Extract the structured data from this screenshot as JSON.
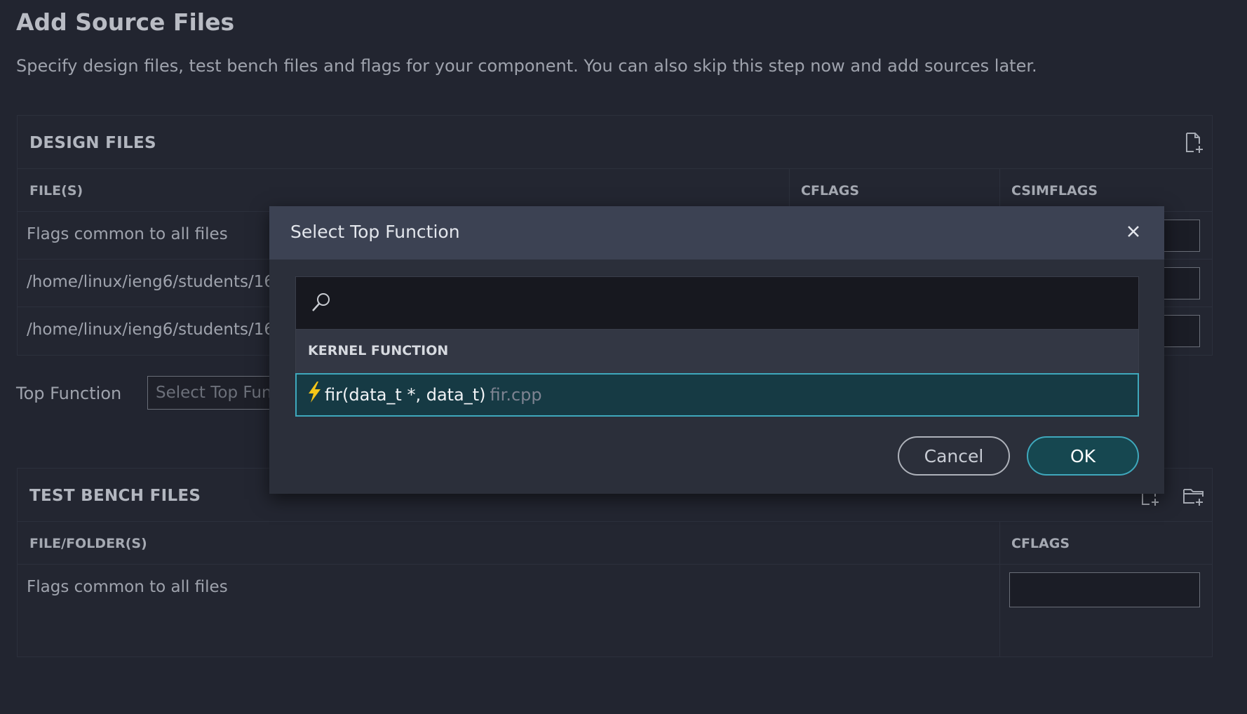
{
  "page": {
    "title": "Add Source Files",
    "description": "Specify design files, test bench files and flags for your component. You can also skip this step now and add sources later."
  },
  "design_files": {
    "title": "DESIGN FILES",
    "add_file_icon": "add-file-icon",
    "columns": [
      "FILE(S)",
      "CFLAGS",
      "CSIMFLAGS"
    ],
    "rows": [
      {
        "label": "Flags common to all files"
      },
      {
        "label": "/home/linux/ieng6/students/16"
      },
      {
        "label": "/home/linux/ieng6/students/16"
      }
    ]
  },
  "top_function": {
    "label": "Top Function",
    "placeholder": "Select Top Fun"
  },
  "test_bench_files": {
    "title": "TEST BENCH FILES",
    "add_file_icon": "add-file-icon",
    "add_folder_icon": "add-folder-icon",
    "columns": [
      "FILE/FOLDER(S)",
      "CFLAGS"
    ],
    "rows": [
      {
        "label": "Flags common to all files"
      }
    ]
  },
  "dialog": {
    "title": "Select Top Function",
    "close_icon": "close-icon",
    "search": {
      "value": "",
      "placeholder": ""
    },
    "list_header": "KERNEL FUNCTION",
    "items": [
      {
        "signature": "fir(data_t *, data_t)",
        "file": "fir.cpp",
        "selected": true
      }
    ],
    "cancel_label": "Cancel",
    "ok_label": "OK"
  },
  "colors": {
    "background": "#222530",
    "dialog_header": "#3c4253",
    "accent": "#3fa8bc",
    "selected_row": "#163a44",
    "bolt": "#f5c518"
  }
}
